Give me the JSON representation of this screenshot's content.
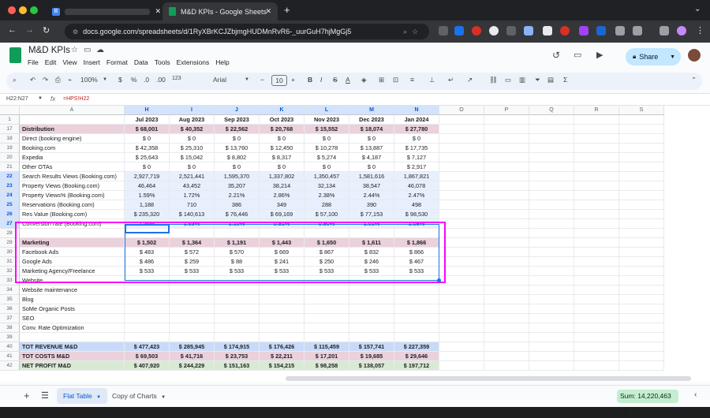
{
  "browser": {
    "tab1_title": "B",
    "tab2_title": "M&D KPIs - Google Sheets",
    "new_tab": "+",
    "url": "docs.google.com/spreadsheets/d/1RyXBrKCJZbjmgHUDMnRvR6-_uurGuH7hjMgGj5"
  },
  "doc": {
    "title": "M&D KPIs",
    "menu": [
      "File",
      "Edit",
      "View",
      "Insert",
      "Format",
      "Data",
      "Tools",
      "Extensions",
      "Help"
    ],
    "share_label": "Share"
  },
  "toolbar": {
    "zoom": "100%",
    "currency": "$",
    "percent": "%",
    "dec_less": ".0",
    "dec_more": ".00",
    "num_fmt": "123",
    "font": "Arial",
    "font_size": "10",
    "bold": "B",
    "italic": "I",
    "strike": "S",
    "text_color": "A"
  },
  "formula_bar": {
    "name_box": "H22:N27",
    "fx": "fx",
    "formula": "=HPS!H22"
  },
  "columns": [
    "A",
    "H",
    "I",
    "J",
    "K",
    "L",
    "M",
    "N",
    "O",
    "P",
    "Q",
    "R",
    "S"
  ],
  "rows": [
    {
      "n": "1",
      "label": "",
      "vals": [
        "Jul 2023",
        "Aug 2023",
        "Sep 2023",
        "Oct 2023",
        "Nov 2023",
        "Dec 2023",
        "Jan 2024"
      ],
      "style": "header"
    },
    {
      "n": "17",
      "label": "Distribution",
      "vals": [
        "$ 68,001",
        "$ 40,352",
        "$ 22,562",
        "$ 20,768",
        "$ 15,552",
        "$ 18,074",
        "$ 27,780"
      ],
      "style": "pink"
    },
    {
      "n": "18",
      "label": "Direct (booking engine)",
      "vals": [
        "$ 0",
        "$ 0",
        "$ 0",
        "$ 0",
        "$ 0",
        "$ 0",
        "$ 0"
      ],
      "style": ""
    },
    {
      "n": "19",
      "label": "Booking.com",
      "vals": [
        "$ 42,358",
        "$ 25,310",
        "$ 13,760",
        "$ 12,450",
        "$ 10,278",
        "$ 13,887",
        "$ 17,735"
      ],
      "style": ""
    },
    {
      "n": "20",
      "label": "Expedia",
      "vals": [
        "$ 25,643",
        "$ 15,042",
        "$ 8,802",
        "$ 8,317",
        "$ 5,274",
        "$ 4,187",
        "$ 7,127"
      ],
      "style": ""
    },
    {
      "n": "21",
      "label": "Other OTAs",
      "vals": [
        "$ 0",
        "$ 0",
        "$ 0",
        "$ 0",
        "$ 0",
        "$ 0",
        "$ 2,917"
      ],
      "style": ""
    },
    {
      "n": "22",
      "label": "Search Results Views (Booking.com)",
      "vals": [
        "2,927,719",
        "2,521,441",
        "1,595,370",
        "1,337,802",
        "1,350,457",
        "1,581,616",
        "1,867,821"
      ],
      "style": "sel"
    },
    {
      "n": "23",
      "label": "Property Views (Booking.com)",
      "vals": [
        "46,464",
        "43,452",
        "35,207",
        "38,214",
        "32,134",
        "38,547",
        "46,078"
      ],
      "style": "sel"
    },
    {
      "n": "24",
      "label": "Property Views% (Booking.com)",
      "vals": [
        "1.59%",
        "1.72%",
        "2.21%",
        "2.86%",
        "2.38%",
        "2.44%",
        "2.47%"
      ],
      "style": "sel"
    },
    {
      "n": "25",
      "label": "Reservations (Booking.com)",
      "vals": [
        "1,188",
        "710",
        "386",
        "349",
        "288",
        "390",
        "498"
      ],
      "style": "sel"
    },
    {
      "n": "26",
      "label": "Res Value (Booking.com)",
      "vals": [
        "$ 235,320",
        "$ 140,613",
        "$ 76,446",
        "$ 69,169",
        "$ 57,100",
        "$ 77,153",
        "$ 98,530"
      ],
      "style": "sel"
    },
    {
      "n": "27",
      "label": "Conversion rate (Booking.com)",
      "vals": [
        "2.56%",
        "1.63%",
        "1.10%",
        "0.91%",
        "0.90%",
        "1.01%",
        "1.08%"
      ],
      "style": "sel"
    },
    {
      "n": "28",
      "label": "",
      "vals": [
        "",
        "",
        "",
        "",
        "",
        "",
        ""
      ],
      "style": ""
    },
    {
      "n": "29",
      "label": "Marketing",
      "vals": [
        "$ 1,502",
        "$ 1,364",
        "$ 1,191",
        "$ 1,443",
        "$ 1,650",
        "$ 1,611",
        "$ 1,866"
      ],
      "style": "pink"
    },
    {
      "n": "30",
      "label": "Facebook Ads",
      "vals": [
        "$ 483",
        "$ 572",
        "$ 570",
        "$ 669",
        "$ 867",
        "$ 832",
        "$ 866"
      ],
      "style": ""
    },
    {
      "n": "31",
      "label": "Google Ads",
      "vals": [
        "$ 486",
        "$ 259",
        "$ 88",
        "$ 241",
        "$ 250",
        "$ 246",
        "$ 467"
      ],
      "style": ""
    },
    {
      "n": "32",
      "label": "Marketing Agency/Freelance",
      "vals": [
        "$ 533",
        "$ 533",
        "$ 533",
        "$ 533",
        "$ 533",
        "$ 533",
        "$ 533"
      ],
      "style": ""
    },
    {
      "n": "33",
      "label": "Website",
      "vals": [
        "",
        "",
        "",
        "",
        "",
        "",
        ""
      ],
      "style": ""
    },
    {
      "n": "34",
      "label": "Website maintenance",
      "vals": [
        "",
        "",
        "",
        "",
        "",
        "",
        ""
      ],
      "style": ""
    },
    {
      "n": "35",
      "label": "Blog",
      "vals": [
        "",
        "",
        "",
        "",
        "",
        "",
        ""
      ],
      "style": ""
    },
    {
      "n": "36",
      "label": "SoMe Organic Posts",
      "vals": [
        "",
        "",
        "",
        "",
        "",
        "",
        ""
      ],
      "style": ""
    },
    {
      "n": "37",
      "label": "SEO",
      "vals": [
        "",
        "",
        "",
        "",
        "",
        "",
        ""
      ],
      "style": ""
    },
    {
      "n": "38",
      "label": "Conv. Rate Optimization",
      "vals": [
        "",
        "",
        "",
        "",
        "",
        "",
        ""
      ],
      "style": ""
    },
    {
      "n": "39",
      "label": "",
      "vals": [
        "",
        "",
        "",
        "",
        "",
        "",
        ""
      ],
      "style": ""
    },
    {
      "n": "40",
      "label": "TOT REVENUE M&D",
      "vals": [
        "$ 477,423",
        "$ 285,945",
        "$ 174,915",
        "$ 176,426",
        "$ 115,459",
        "$ 157,741",
        "$ 227,359"
      ],
      "style": "blue"
    },
    {
      "n": "41",
      "label": "TOT COSTS M&D",
      "vals": [
        "$ 69,503",
        "$ 41,716",
        "$ 23,753",
        "$ 22,211",
        "$ 17,201",
        "$ 19,685",
        "$ 29,646"
      ],
      "style": "pink"
    },
    {
      "n": "42",
      "label": "NET PROFIT M&D",
      "vals": [
        "$ 407,920",
        "$ 244,229",
        "$ 151,163",
        "$ 154,215",
        "$ 98,258",
        "$ 138,057",
        "$ 197,712"
      ],
      "style": "green"
    }
  ],
  "sheets": {
    "tabs": [
      "Flat Table",
      "Copy of Charts"
    ],
    "add": "+",
    "sum": "Sum: 14,220,463"
  },
  "colors": {
    "highlight": "#ff00ff",
    "accent": "#0b57d0",
    "pink": "#ead1dc",
    "blue": "#c9daf8",
    "green": "#d9ead3"
  }
}
